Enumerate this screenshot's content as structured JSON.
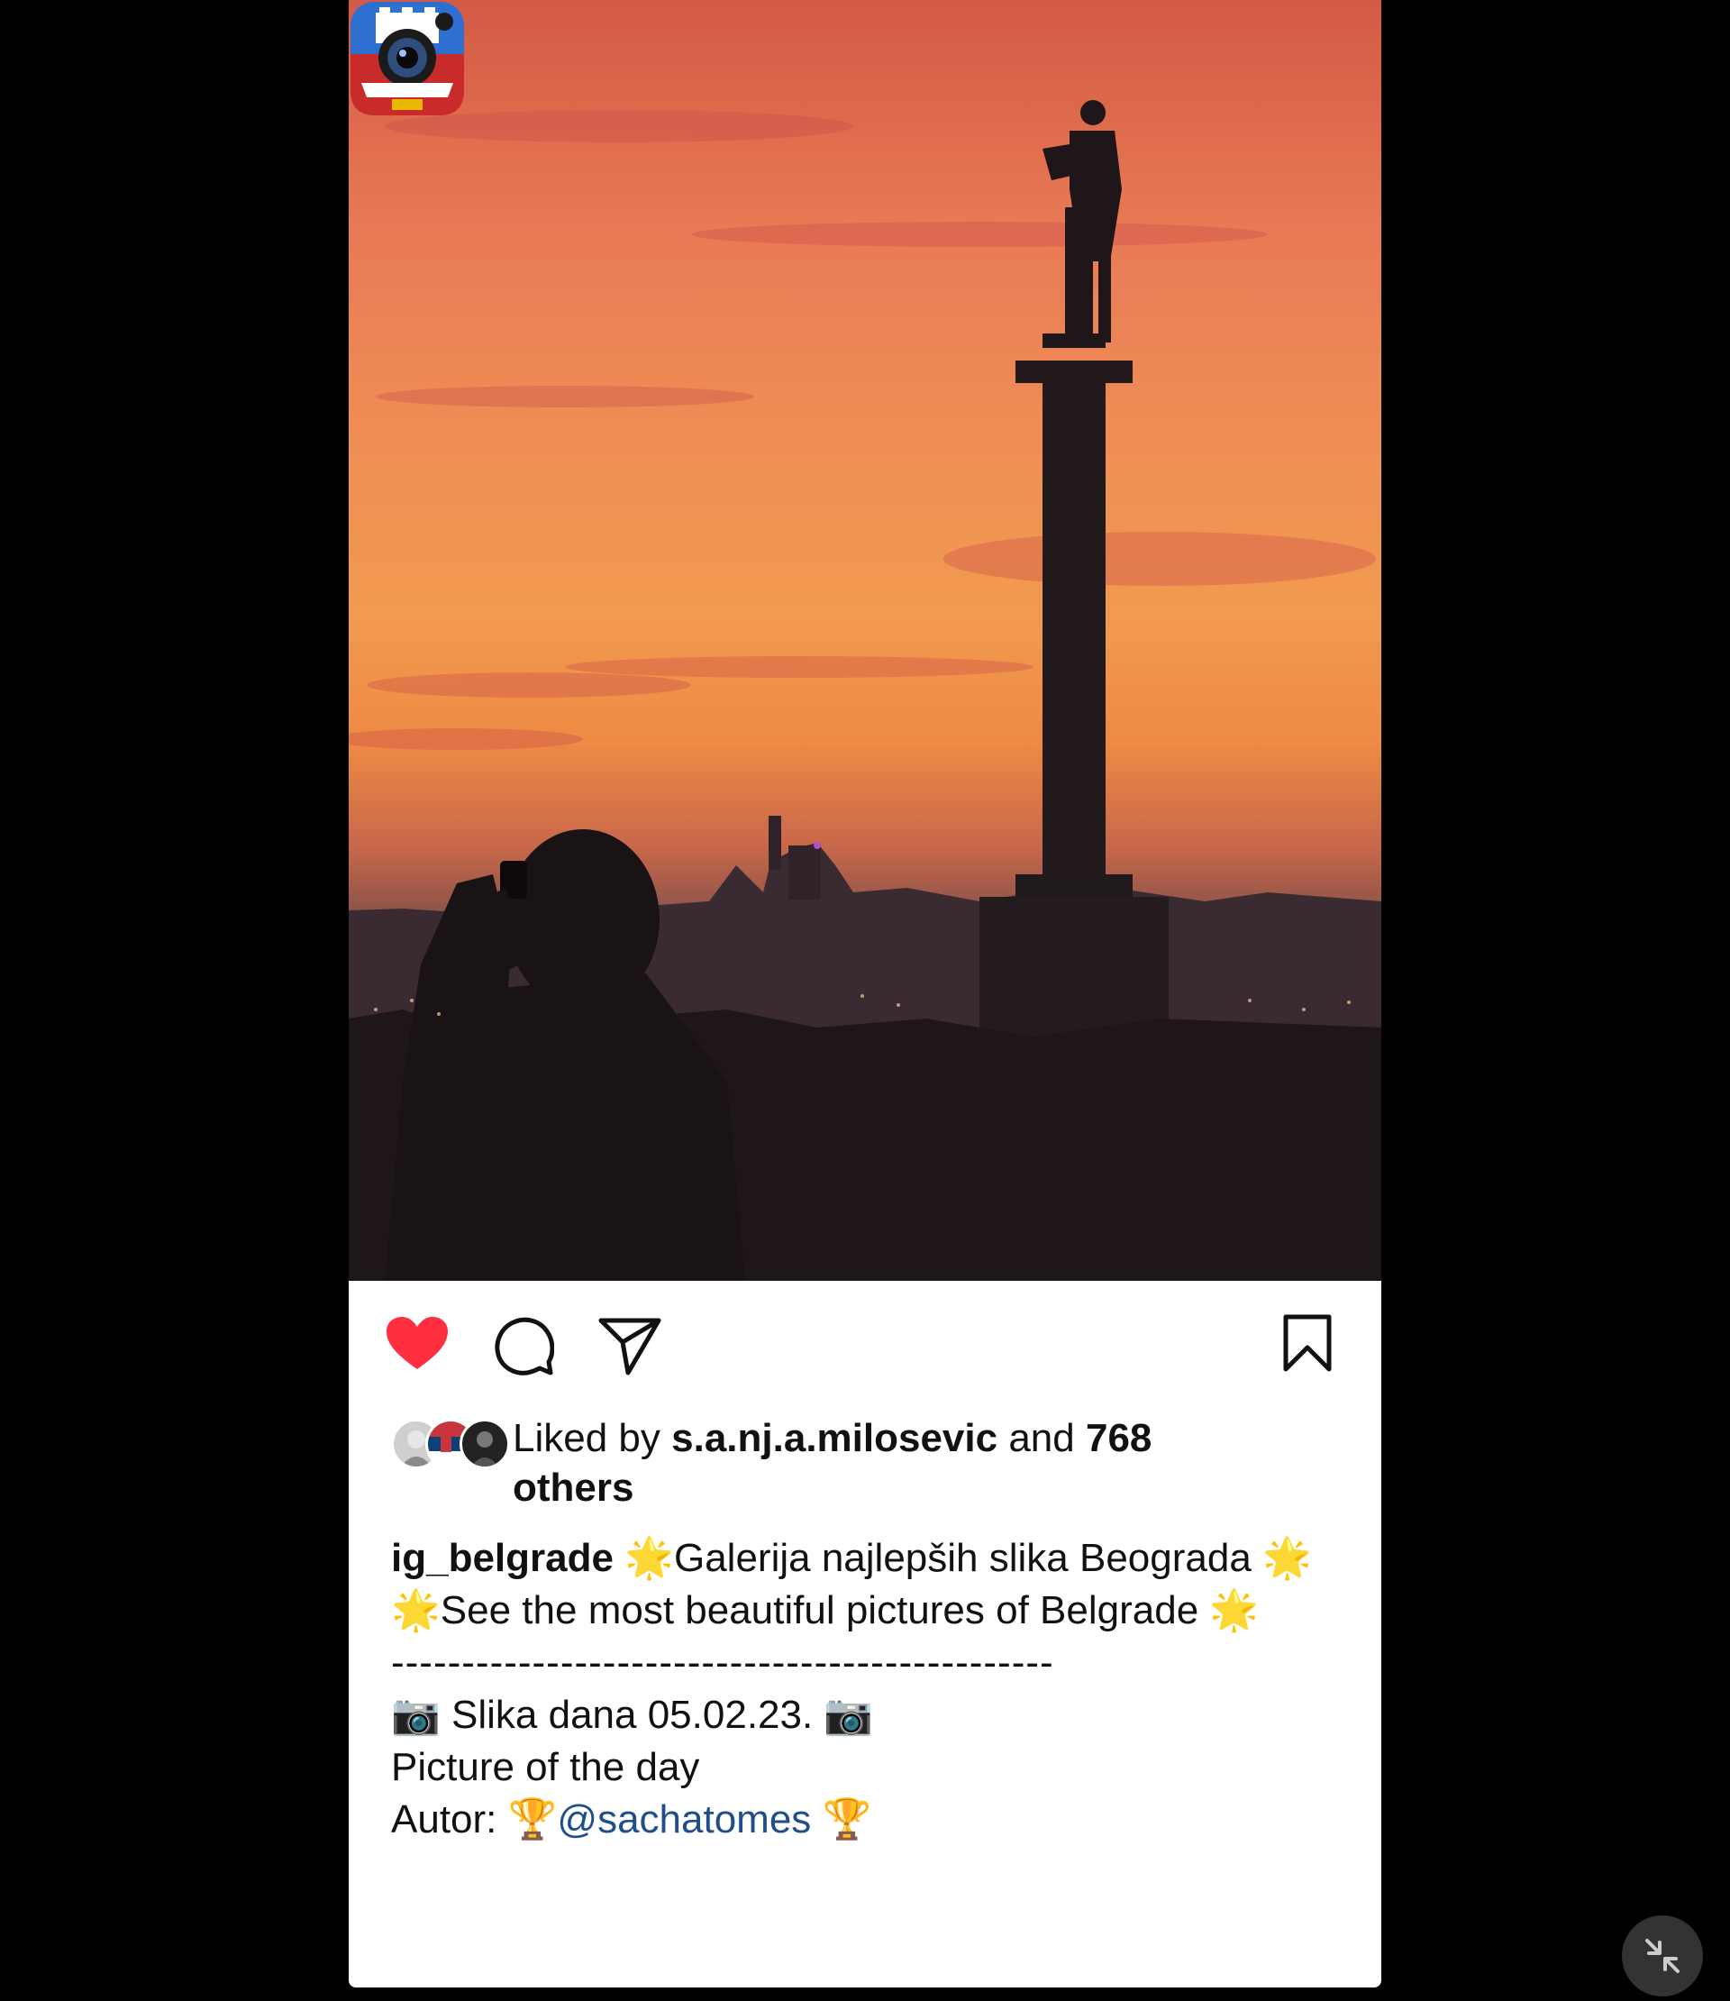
{
  "post": {
    "liked_by_prefix": "Liked by",
    "liked_by_user": "s.a.nj.a.milosevic",
    "liked_by_and": "and",
    "likes_count": "768",
    "likes_others": "others",
    "username": "ig_belgrade",
    "caption_line1": "🌟Galerija najlepših slika Beograda 🌟",
    "caption_line2": "🌟See the most beautiful pictures of Belgrade 🌟",
    "divider": "-----------------------------------------------",
    "caption_line3": "📷 Slika dana 05.02.23. 📷",
    "caption_line4": "Picture of the day",
    "author_prefix": "Autor: 🏆",
    "author_mention": "@sachatomes",
    "author_suffix": "🏆"
  },
  "actions": {
    "like_icon": "heart-filled-icon",
    "comment_icon": "comment-icon",
    "share_icon": "send-icon",
    "save_icon": "bookmark-icon",
    "collapse_icon": "collapse-icon"
  },
  "colors": {
    "heart": "#ff2f40",
    "mention": "#1f4f8a",
    "card_bg": "#ffffff",
    "page_bg": "#000000"
  }
}
